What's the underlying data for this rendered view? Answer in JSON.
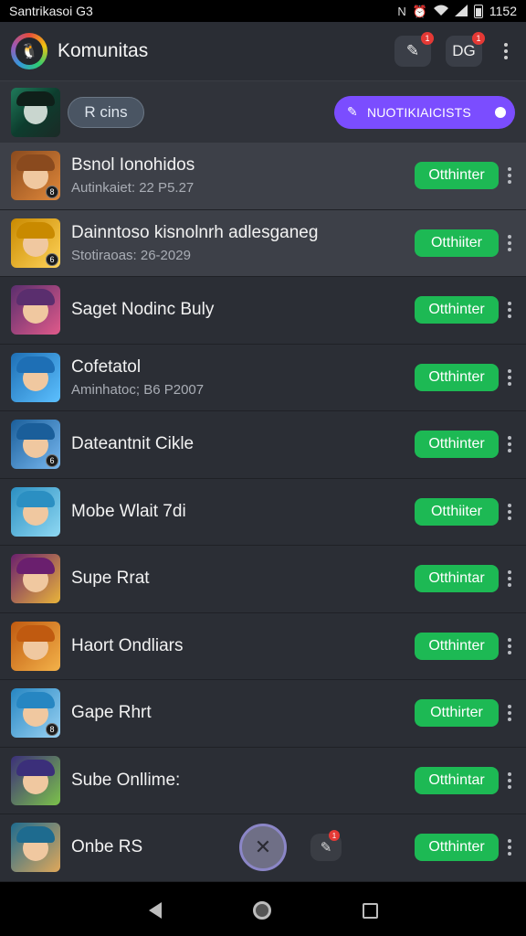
{
  "status_bar": {
    "left_text": "Santrikasoi G3",
    "time": "1152",
    "icons": [
      "nfc-icon",
      "alarm-icon",
      "wifi-icon",
      "signal-icon",
      "battery-icon"
    ]
  },
  "header": {
    "title": "Komunitas",
    "notif_badge": "1",
    "dg_label": "DG",
    "dg_badge": "1"
  },
  "toolbar": {
    "search_label": "R cins",
    "promo_label": "NUOTIKIAICISTS"
  },
  "rows": [
    {
      "title": "Bsnol Ionohidos",
      "subtitle": "Autinkaiet: 22 P5.27",
      "action": "Otthinter",
      "colors": [
        "#8a4a1e",
        "#e0883a"
      ],
      "badge": "8"
    },
    {
      "title": "Dainntoso kisnolnrh adlesganeg",
      "subtitle": "Stotiraoas: 26-2029",
      "action": "Otthiiter",
      "colors": [
        "#c98a00",
        "#ffd35a"
      ],
      "badge": "6"
    },
    {
      "title": "Saget Nodinc Buly",
      "subtitle": "",
      "action": "Otthinter",
      "colors": [
        "#5a2e6e",
        "#e05a8a"
      ],
      "badge": ""
    },
    {
      "title": "Cofetatol",
      "subtitle": "Aminhatoc; B6 P2007",
      "action": "Otthinter",
      "colors": [
        "#1e6fb5",
        "#5cc0ff"
      ],
      "badge": ""
    },
    {
      "title": "Dateantnit Cikle",
      "subtitle": "",
      "action": "Otthinter",
      "colors": [
        "#1a5e9a",
        "#78b8f0"
      ],
      "badge": "6"
    },
    {
      "title": "Mobe Wlait 7di",
      "subtitle": "",
      "action": "Otthiiter",
      "colors": [
        "#2b8fc2",
        "#8fd8f2"
      ],
      "badge": ""
    },
    {
      "title": "Supe Rrat",
      "subtitle": "",
      "action": "Otthintar",
      "colors": [
        "#6a1f6e",
        "#e9b43a"
      ],
      "badge": ""
    },
    {
      "title": "Haort Ondliars",
      "subtitle": "",
      "action": "Otthinter",
      "colors": [
        "#c05a10",
        "#f3b24a"
      ],
      "badge": ""
    },
    {
      "title": "Gape Rhrt",
      "subtitle": "",
      "action": "Otthirter",
      "colors": [
        "#2686c2",
        "#9ad2f3"
      ],
      "badge": "8"
    },
    {
      "title": "Sube Onllime:",
      "subtitle": "",
      "action": "Otthintar",
      "colors": [
        "#3b2f7a",
        "#7cc24a"
      ],
      "badge": ""
    },
    {
      "title": "Onbe RS",
      "subtitle": "",
      "action": "Otthinter",
      "colors": [
        "#1e6b8f",
        "#e0a85a"
      ],
      "badge": ""
    }
  ],
  "float_icon": {
    "badge": "1"
  }
}
